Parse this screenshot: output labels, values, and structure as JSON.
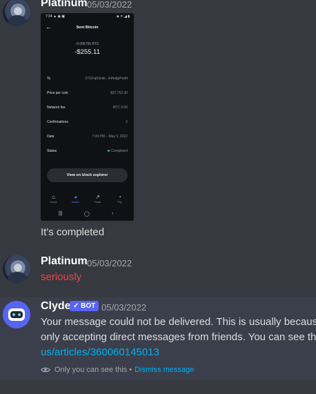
{
  "messages": [
    {
      "author": "Platinum",
      "timestamp": "05/03/2022",
      "attachment": {
        "status_time": "7:34 ▲ ◉ ▣",
        "status_icons": "◈ ᯤ ◢ ▮",
        "back_icon": "arrow-left-icon",
        "title": "Sent Bitcoin",
        "amount_btc": "-0.006756 BTC",
        "amount_usd": "-$255.11",
        "rows": [
          {
            "label": "To",
            "value": "37GFvjh3ekk...44fedjpPed4"
          },
          {
            "label": "Price per coin",
            "value": "$37,762.30"
          },
          {
            "label": "Network fee",
            "value": "BTC 0.00"
          },
          {
            "label": "Confirmations",
            "value": "2"
          },
          {
            "label": "Date",
            "value": "7:09 PM – May 3, 2022"
          },
          {
            "label": "Status",
            "value": "Completed"
          }
        ],
        "status_color": "#2bbd7e",
        "explorer_button": "View on block explorer",
        "nav": [
          {
            "label": "Home",
            "icon": "home-icon"
          },
          {
            "label": "Assets",
            "icon": "pie-chart-icon"
          },
          {
            "label": "Trade",
            "icon": "trend-icon"
          },
          {
            "label": "Pay",
            "icon": "pay-icon"
          }
        ],
        "sys_nav": [
          "|||",
          "◯",
          "‹"
        ]
      },
      "text": "It's completed"
    },
    {
      "author": "Platinum",
      "timestamp": "05/03/2022",
      "text": "seriously",
      "text_color": "#ed4245"
    },
    {
      "author": "Clyde",
      "bot_tag": "✓ BOT",
      "timestamp": "05/03/2022",
      "text_line1": "Your message could not be delivered. This is usually because",
      "text_line2": "only accepting direct messages from friends. You can see the",
      "link": "us/articles/360060145013",
      "footer_text": "Only you can see this •",
      "dismiss_link": "Dismiss message"
    }
  ],
  "colors": {
    "background": "#36393f",
    "ephemeral_background": "#3b3f4b",
    "link": "#00aff4",
    "bot_tag": "#5865f2"
  }
}
